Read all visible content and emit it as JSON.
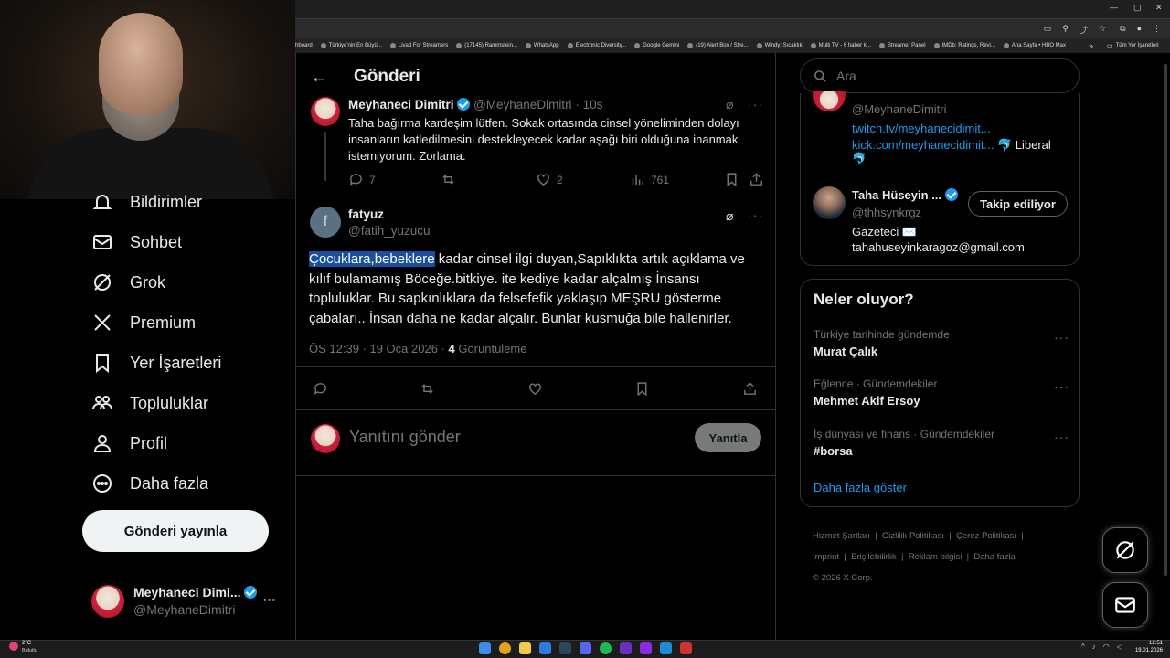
{
  "browser": {
    "bookmarks": [
      "hboard",
      "Türkiye'nin En Büyü...",
      "Livad For Streamers",
      "(17145) Rammstein...",
      "WhatsApp",
      "Electronic Diversity...",
      "Google Gemini",
      "(19) Alert Box / Stre...",
      "Windy: Sıcaklık",
      "Multi TV - 6 haber k...",
      "Streamer Panel",
      "IMDb: Ratings, Revi...",
      "Ana Sayfa • HBO Max"
    ],
    "bookmarks_more": "»",
    "all_bookmarks": "Tüm Yer İşaretleri"
  },
  "nav": {
    "items": [
      {
        "label": "Bildirimler",
        "icon": "bell-icon"
      },
      {
        "label": "Sohbet",
        "icon": "mail-icon"
      },
      {
        "label": "Grok",
        "icon": "grok-icon"
      },
      {
        "label": "Premium",
        "icon": "x-logo-icon"
      },
      {
        "label": "Yer İşaretleri",
        "icon": "bookmark-icon"
      },
      {
        "label": "Topluluklar",
        "icon": "people-icon"
      },
      {
        "label": "Profil",
        "icon": "person-icon"
      },
      {
        "label": "Daha fazla",
        "icon": "more-circle-icon"
      }
    ],
    "post_button": "Gönderi yayınla",
    "account": {
      "name": "Meyhaneci Dimi...",
      "handle": "@MeyhaneDimitri",
      "more": "···"
    }
  },
  "main": {
    "header_title": "Gönderi",
    "parent_tweet": {
      "name": "Meyhaneci Dimitri",
      "handle": "@MeyhaneDimitri",
      "time": "· 10s",
      "text": "Taha bağırma kardeşim lütfen. Sokak ortasında cinsel yöneliminden dolayı insanların katledilmesini destekleyecek kadar aşağı biri olduğuna inanmak istemiyorum. Zorlama.",
      "replies": "7",
      "likes": "2",
      "views": "761"
    },
    "tweet": {
      "name": "fatyuz",
      "handle": "@fatih_yuzucu",
      "avatar_letter": "f",
      "text_highlight": "Çocuklara,bebeklere",
      "text_rest": " kadar cinsel ilgi duyan,Sapıklıkta artık açıklama ve kılıf bulamamış Böceğe.bitkiye. ite kediye kadar alçalmış İnsansı topluluklar. Bu sapkınlıklara da felsefefik yaklaşıp MEŞRU gösterme çabaları.. İnsan daha ne kadar alçalır. Bunlar kusmuğa bile hallenirler.",
      "meta_time": "ÖS 12:39 · 19 Oca 2026 · ",
      "meta_views_count": "4",
      "meta_views_label": " Görüntüleme"
    },
    "reply": {
      "placeholder": "Yanıtını gönder",
      "button": "Yanıtla"
    }
  },
  "right": {
    "search_placeholder": "Ara",
    "profile_card": {
      "handle": "@MeyhaneDimitri",
      "link1": "twitch.tv/meyhanecidimit...",
      "link2": "kick.com/meyhanecidimit...",
      "bio_tail": " 🐬 Liberal",
      "bio_emoji": "🐬"
    },
    "follow_card": {
      "name": "Taha Hüseyin ...",
      "handle": "@thhsynkrgz",
      "button": "Takip ediliyor",
      "bio1": "Gazeteci ✉️",
      "bio2": "tahahuseyinkaragoz@gmail.com"
    },
    "trends": {
      "title": "Neler oluyor?",
      "items": [
        {
          "meta": "Türkiye tarihinde gündemde",
          "name": "Murat Çalık"
        },
        {
          "meta": "Eğlence · Gündemdekiler",
          "name": "Mehmet Akif Ersoy"
        },
        {
          "meta": "İş dünyası ve finans · Gündemdekiler",
          "name": "#borsa"
        }
      ],
      "show_more": "Daha fazla göster"
    },
    "footer": {
      "links": [
        "Hizmet Şartları",
        "Gizlilik Politikası",
        "Çerez Politikası",
        "Imprint",
        "Erişilebilirlik",
        "Reklam bilgisi",
        "Daha fazla ···"
      ],
      "copyright": "© 2026 X Corp."
    }
  },
  "taskbar": {
    "weather_temp": "2°C",
    "weather_desc": "Bulutlu",
    "time": "12:51",
    "date": "19.01.2026"
  }
}
